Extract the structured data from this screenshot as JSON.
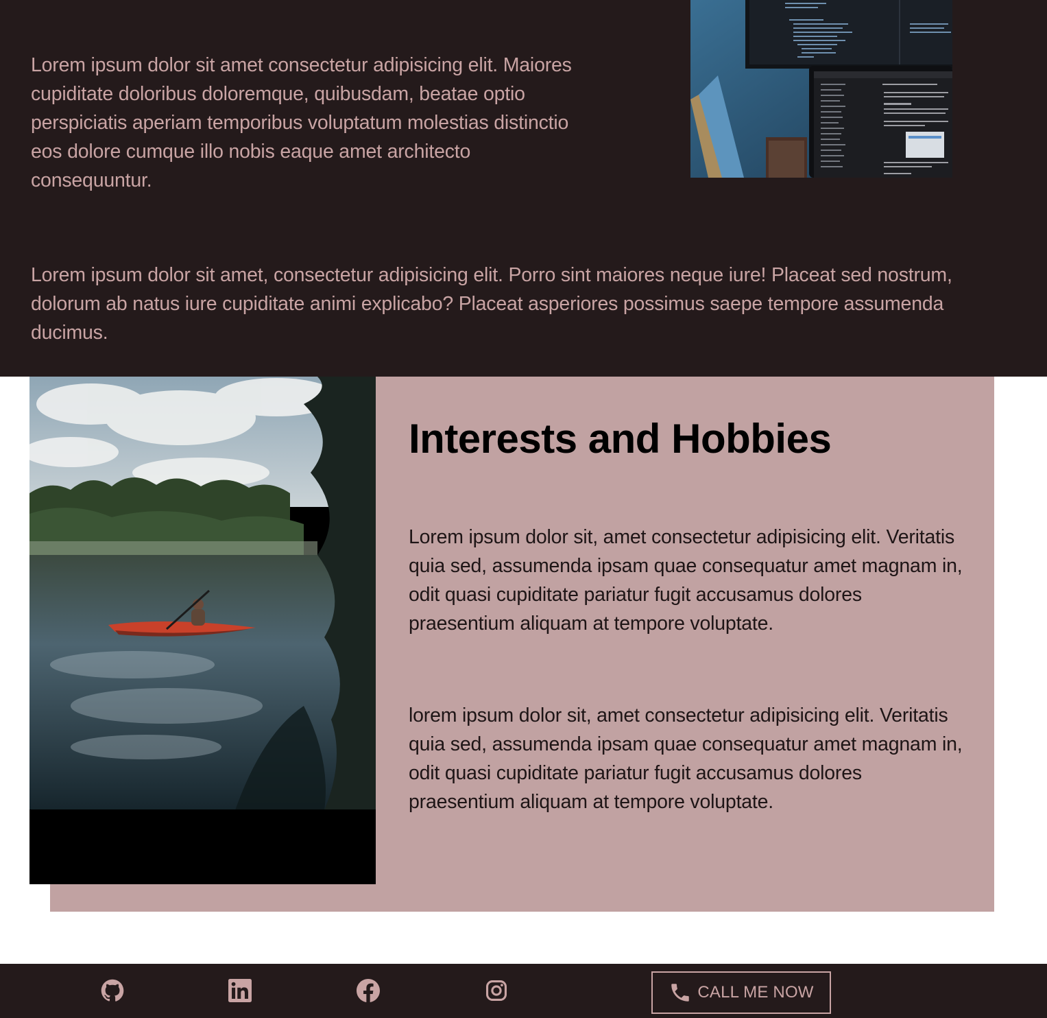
{
  "intro": {
    "paragraph": "Lorem ipsum dolor sit amet consectetur adipisicing elit. Maiores cupiditate doloribus doloremque, quibusdam, beatae optio perspiciatis aperiam temporibus voluptatum molestias distinctio eos dolore cumque illo nobis eaque amet architecto consequuntur.",
    "second_paragraph": "Lorem ipsum dolor sit amet, consectetur adipisicing elit. Porro sint maiores neque iure! Placeat sed nostrum, dolorum ab natus iure cupiditate animi explicabo? Placeat asperiores possimus saepe tempore assumenda ducimus."
  },
  "hobbies": {
    "title": "Interests and Hobbies",
    "paragraph_1": "Lorem ipsum dolor sit, amet consectetur adipisicing elit. Veritatis quia sed, assumenda ipsam quae consequatur amet magnam in, odit quasi cupiditate pariatur fugit accusamus dolores praesentium aliquam at tempore voluptate.",
    "paragraph_2": "lorem ipsum dolor sit, amet consectetur adipisicing elit. Veritatis quia sed, assumenda ipsam quae consequatur amet magnam in, odit quasi cupiditate pariatur fugit accusamus dolores praesentium aliquam at tempore voluptate."
  },
  "footer": {
    "social_icons": [
      "github-icon",
      "linkedin-icon",
      "facebook-icon",
      "instagram-icon"
    ],
    "call_button_label": "CALL ME NOW",
    "call_icon": "phone-icon"
  },
  "colors": {
    "dark_background": "#241a1b",
    "accent_text": "#c9a4a4",
    "panel_background": "#c1a2a2"
  }
}
